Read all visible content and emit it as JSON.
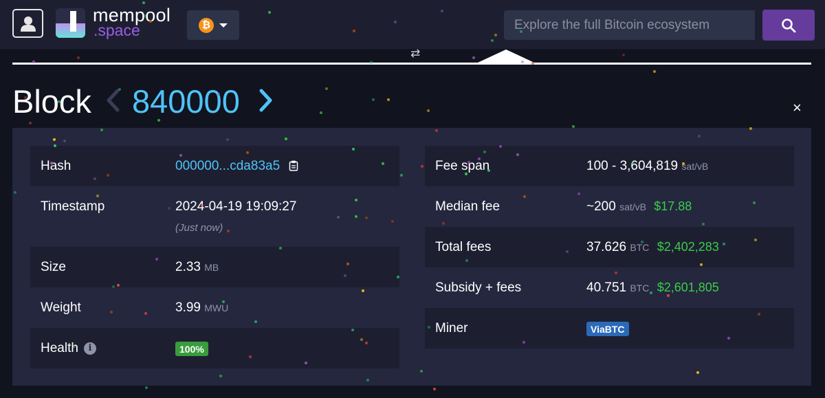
{
  "header": {
    "logo_line1": "mempool",
    "logo_line2": ".space",
    "network_symbol": "₿",
    "search_placeholder": "Explore the full Bitcoin ecosystem",
    "icons": [
      "user-icon",
      "bitcoin-icon",
      "chevron-down-icon",
      "search-icon"
    ]
  },
  "blockchain": {
    "swap_symbol": "⇄"
  },
  "title": {
    "label": "Block",
    "height": "840000",
    "close_symbol": "×"
  },
  "details_left": {
    "hash": {
      "label": "Hash",
      "value": "000000...cda83a5"
    },
    "timestamp": {
      "label": "Timestamp",
      "value": "2024-04-19 19:09:27",
      "relative": "(Just now)"
    },
    "size": {
      "label": "Size",
      "value": "2.33",
      "unit": "MB"
    },
    "weight": {
      "label": "Weight",
      "value": "3.99",
      "unit": "MWU"
    },
    "health": {
      "label": "Health",
      "info_symbol": "i",
      "value": "100%"
    }
  },
  "details_right": {
    "fee_span": {
      "label": "Fee span",
      "value": "100 - 3,604,819",
      "unit": "sat/vB"
    },
    "median_fee": {
      "label": "Median fee",
      "value": "~200",
      "unit": "sat/vB",
      "fiat": "$17.88"
    },
    "total_fees": {
      "label": "Total fees",
      "value": "37.626",
      "unit": "BTC",
      "fiat": "$2,402,283"
    },
    "subsidy_fees": {
      "label": "Subsidy + fees",
      "value": "40.751",
      "unit": "BTC",
      "fiat": "$2,601,805"
    },
    "miner": {
      "label": "Miner",
      "value": "ViaBTC"
    }
  },
  "colors": {
    "accent_link": "#4fc3f7",
    "fiat_green": "#3bcc49",
    "search_button": "#653b9c",
    "logo_purple": "#9b5de5",
    "health_badge": "#3a9b3d",
    "miner_badge": "#2b6ab8",
    "bitcoin_orange": "#f7931a"
  }
}
